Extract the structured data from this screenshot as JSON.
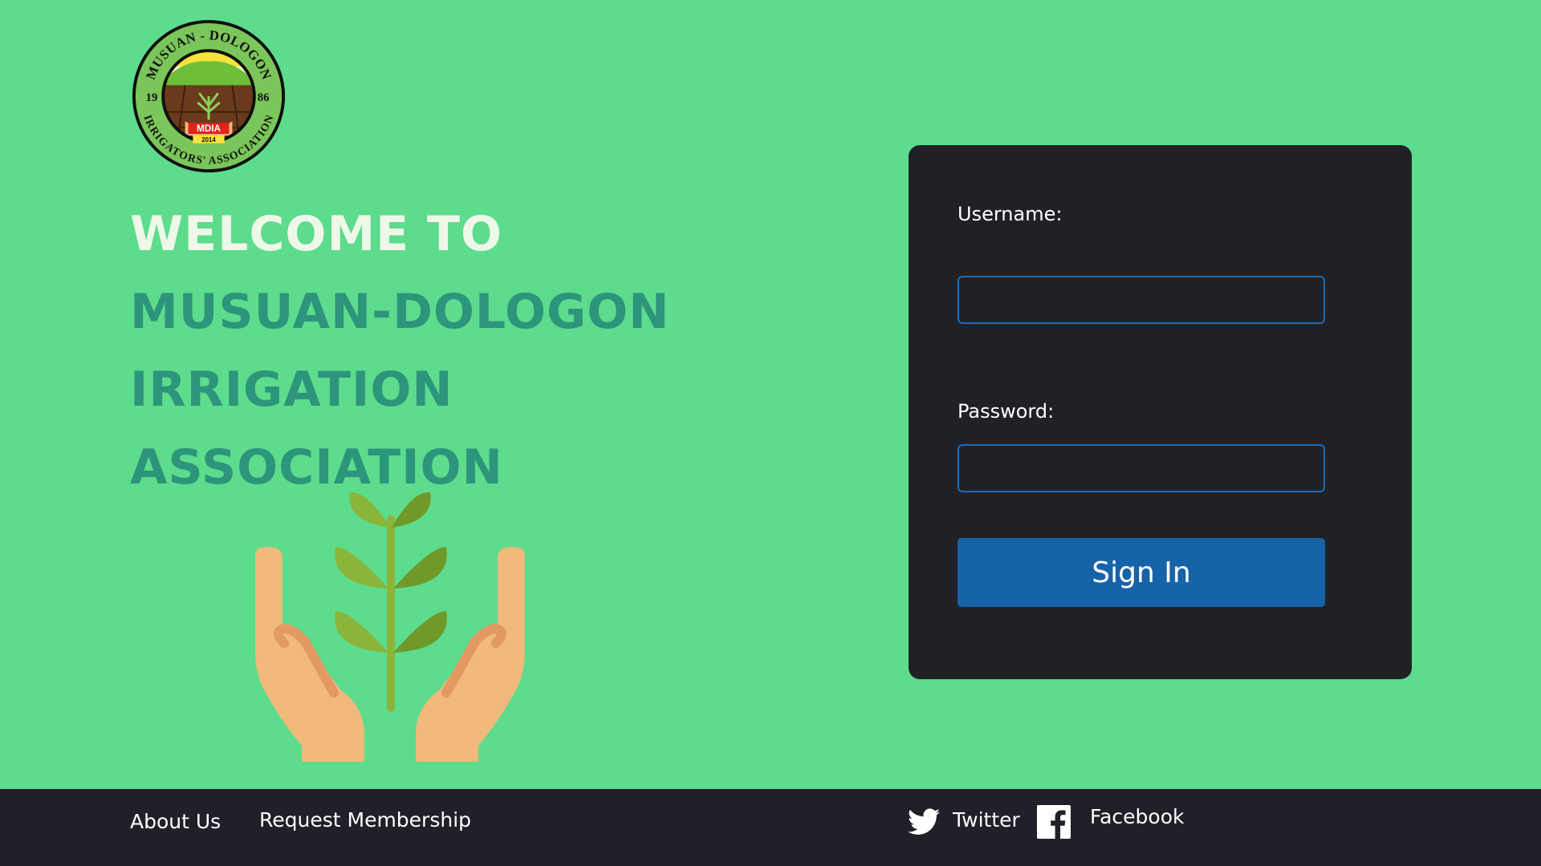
{
  "logo": {
    "top_text": "MUSUAN - DOLOGON",
    "bottom_text": "IRRIGATORS' ASSOCIATION",
    "year_left": "19",
    "year_right": "86",
    "abbr": "MDIA",
    "year_banner": "2014"
  },
  "welcome": {
    "line1": "WELCOME TO",
    "line2_a": "MUSUAN-",
    "line2_b": "DOLOGON",
    "line3": "IRRIGATION",
    "line4": "ASSOCIATION"
  },
  "login": {
    "username_label": "Username:",
    "username_value": "",
    "password_label": "Password:",
    "password_value": "",
    "signin_label": "Sign In"
  },
  "footer": {
    "about": "About Us",
    "membership": "Request Membership",
    "twitter": "Twitter",
    "facebook": "Facebook"
  },
  "colors": {
    "background": "#5cdc8c",
    "card": "#202127",
    "footer": "#1f2028",
    "button": "#1763a8",
    "heading_light": "#eef8e9",
    "heading_teal": "#2d957b"
  }
}
